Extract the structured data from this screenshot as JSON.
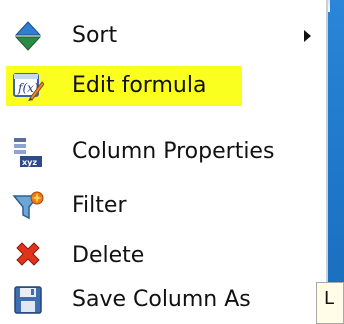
{
  "colors": {
    "highlight": "#fbff1f",
    "menu_background": "#ffffff",
    "backdrop": "#2a86d8"
  },
  "menu": {
    "items": [
      {
        "label": "Sort",
        "icon": "sort-arrows-icon",
        "has_submenu": true
      },
      {
        "label": "Edit formula",
        "icon": "formula-edit-icon",
        "highlighted": true
      },
      {
        "label": "Column Properties",
        "icon": "column-properties-icon"
      },
      {
        "label": "Filter",
        "icon": "filter-funnel-icon"
      },
      {
        "label": "Delete",
        "icon": "delete-x-icon"
      },
      {
        "label": "Save Column As",
        "icon": "save-disk-icon"
      }
    ]
  },
  "corner_panel": {
    "label": "L"
  }
}
